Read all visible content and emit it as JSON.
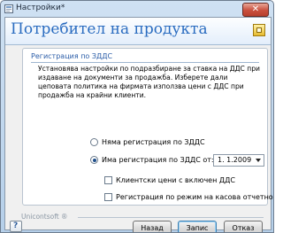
{
  "window": {
    "title": "Настройки*",
    "close_glyph": "✕"
  },
  "header": {
    "title": "Потребител на продукта",
    "icon": "window-frame-icon"
  },
  "section": {
    "title": "Регистрация по ЗДДС",
    "description": "Установява настройки по подразбиране за ставка на ДДС при издаване на документи за продажба. Изберете дали цеповата политика на фирмата използва цени с ДДС при продажба на крайни клиенти."
  },
  "options": {
    "no_vat_label": "Няма регистрация по ЗДДС",
    "vat_label": "Има регистрация по ЗДДС от:",
    "selected": "vat",
    "vat_date": "1. 1.2009",
    "prices_with_vat_label": "Клиентски цени с включен ДДС",
    "cash_register_label": "Регистрация по режим на касова отчетност"
  },
  "footer": {
    "brand": "Unicontsoft ®",
    "back_label": "Назад",
    "save_label": "Запис",
    "cancel_label": "Отказ"
  }
}
